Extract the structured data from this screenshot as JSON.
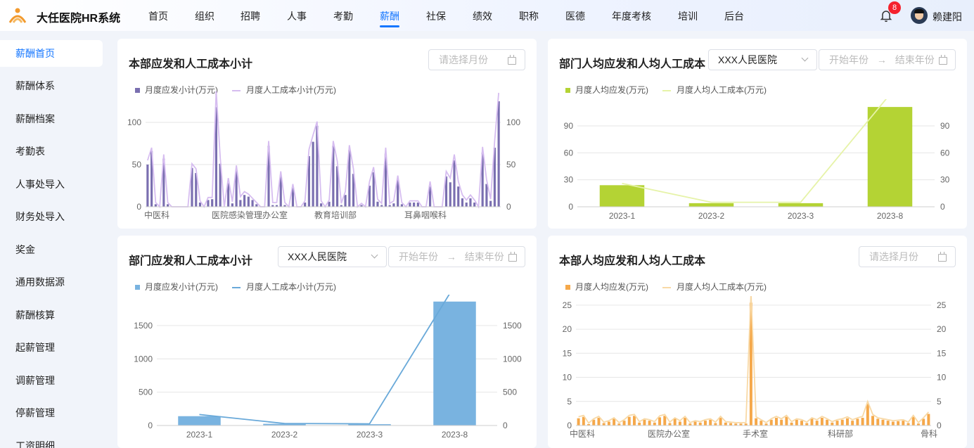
{
  "app": {
    "title": "大任医院HR系统"
  },
  "nav": [
    {
      "label": "首页",
      "active": false
    },
    {
      "label": "组织",
      "active": false
    },
    {
      "label": "招聘",
      "active": false
    },
    {
      "label": "人事",
      "active": false
    },
    {
      "label": "考勤",
      "active": false
    },
    {
      "label": "薪酬",
      "active": true
    },
    {
      "label": "社保",
      "active": false
    },
    {
      "label": "绩效",
      "active": false
    },
    {
      "label": "职称",
      "active": false
    },
    {
      "label": "医德",
      "active": false
    },
    {
      "label": "年度考核",
      "active": false
    },
    {
      "label": "培训",
      "active": false
    },
    {
      "label": "后台",
      "active": false
    }
  ],
  "user": {
    "name": "赖建阳",
    "notifications": "8"
  },
  "sidebar": [
    {
      "label": "薪酬首页",
      "active": true
    },
    {
      "label": "薪酬体系"
    },
    {
      "label": "薪酬档案"
    },
    {
      "label": "考勤表"
    },
    {
      "label": "人事处导入"
    },
    {
      "label": "财务处导入"
    },
    {
      "label": "奖金"
    },
    {
      "label": "通用数据源"
    },
    {
      "label": "薪酬核算"
    },
    {
      "label": "起薪管理"
    },
    {
      "label": "调薪管理"
    },
    {
      "label": "停薪管理"
    },
    {
      "label": "工资明细"
    }
  ],
  "colors": {
    "accent": "#1677ff",
    "purple": "#7a6fb0",
    "purple_line": "#d6bdf0",
    "green": "#b4d334",
    "green_line": "#e6f3a8",
    "blue": "#79b3e0",
    "blue_line": "#69a9d9",
    "orange": "#f5a84a",
    "orange_line": "#f8d9a6"
  },
  "cards": {
    "c1": {
      "title": "本部应发和人工成本小计",
      "month_placeholder": "请选择月份"
    },
    "c2": {
      "title": "部门人均应发和人均人工成本",
      "hospital": "XXX人民医院",
      "start_placeholder": "开始年份",
      "end_placeholder": "结束年份",
      "arrow": "→"
    },
    "c3": {
      "title": "部门应发和人工成本小计",
      "hospital": "XXX人民医院",
      "start_placeholder": "开始年份",
      "end_placeholder": "结束年份",
      "arrow": "→"
    },
    "c4": {
      "title": "本部人均应发和人均人工成本",
      "month_placeholder": "请选择月份"
    }
  },
  "chart_data": [
    {
      "type": "bar",
      "legend": [
        "月度应发小计(万元)",
        "月度人工成本小计(万元)"
      ],
      "x_tick_labels": [
        "中医科",
        "医院感染管理办公室",
        "教育培训部",
        "耳鼻咽喉科"
      ],
      "y_ticks": [
        0,
        50,
        100
      ],
      "ylim": [
        0,
        135
      ],
      "series": [
        {
          "name": "月度应发小计(万元)",
          "kind": "bar",
          "values": [
            50,
            66,
            3,
            0,
            57,
            3,
            0,
            0,
            0,
            0,
            0,
            46,
            40,
            5,
            0,
            8,
            9,
            118,
            51,
            0,
            28,
            4,
            43,
            8,
            14,
            12,
            8,
            3,
            0,
            0,
            72,
            2,
            2,
            37,
            2,
            0,
            23,
            0,
            0,
            5,
            60,
            77,
            96,
            4,
            0,
            6,
            72,
            48,
            2,
            14,
            67,
            39,
            0,
            2,
            0,
            25,
            41,
            6,
            2,
            63,
            2,
            4,
            32,
            3,
            0,
            5,
            5,
            5,
            0,
            0,
            24,
            0,
            0,
            0,
            36,
            29,
            55,
            24,
            10,
            5,
            10,
            5,
            0,
            64,
            27,
            7,
            70,
            125
          ]
        },
        {
          "name": "月度人工成本小计(万元)",
          "kind": "line",
          "values": [
            55,
            70,
            5,
            0,
            62,
            5,
            0,
            0,
            0,
            0,
            0,
            51,
            45,
            7,
            0,
            11,
            11,
            137,
            58,
            0,
            34,
            6,
            49,
            12,
            18,
            15,
            10,
            5,
            0,
            0,
            78,
            5,
            5,
            42,
            5,
            0,
            27,
            0,
            0,
            7,
            68,
            85,
            101,
            7,
            0,
            8,
            78,
            54,
            4,
            18,
            73,
            45,
            0,
            4,
            0,
            30,
            47,
            9,
            4,
            70,
            4,
            7,
            37,
            5,
            0,
            7,
            7,
            7,
            0,
            0,
            30,
            0,
            0,
            0,
            42,
            34,
            62,
            30,
            14,
            8,
            14,
            8,
            0,
            71,
            32,
            9,
            78,
            135
          ]
        }
      ]
    },
    {
      "type": "bar",
      "legend": [
        "月度人均应发(万元)",
        "月度人均人工成本(万元)"
      ],
      "categories": [
        "2023-1",
        "2023-2",
        "2023-3",
        "2023-8"
      ],
      "y_ticks": [
        0,
        30,
        60,
        90
      ],
      "ylim": [
        0,
        115
      ],
      "series": [
        {
          "name": "月度人均应发(万元)",
          "kind": "bar",
          "values": [
            24,
            4,
            4,
            111
          ]
        },
        {
          "name": "月度人均人工成本(万元)",
          "kind": "line",
          "values": [
            26,
            5,
            5,
            125
          ]
        }
      ]
    },
    {
      "type": "bar",
      "legend": [
        "月度应发小计(万元)",
        "月度人工成本小计(万元)"
      ],
      "categories": [
        "2023-1",
        "2023-2",
        "2023-3",
        "2023-8"
      ],
      "y_ticks": [
        0,
        500,
        1000,
        1500
      ],
      "ylim": [
        0,
        1900
      ],
      "series": [
        {
          "name": "月度应发小计(万元)",
          "kind": "bar",
          "values": [
            140,
            25,
            20,
            1860
          ]
        },
        {
          "name": "月度人工成本小计(万元)",
          "kind": "line",
          "values": [
            165,
            30,
            25,
            2100
          ]
        }
      ]
    },
    {
      "type": "bar",
      "legend": [
        "月度人均应发(万元)",
        "月度人均人工成本(万元)"
      ],
      "x_tick_labels": [
        "中医科",
        "医院办公室",
        "手术室",
        "科研部",
        "骨科"
      ],
      "y_ticks": [
        0,
        5,
        10,
        15,
        20,
        25
      ],
      "ylim": [
        0,
        26
      ],
      "series": [
        {
          "name": "月度人均应发(万元)",
          "kind": "bar",
          "values": [
            1.5,
            1.8,
            0.3,
            1.2,
            1.6,
            0.5,
            0.8,
            1.4,
            0.4,
            1.0,
            1.8,
            2.0,
            0.6,
            1.2,
            1.0,
            0.6,
            1.7,
            2.0,
            0.5,
            1.4,
            0.8,
            1.6,
            0.4,
            0.8,
            0.6,
            1.0,
            1.2,
            0.5,
            1.6,
            0.6,
            0.5,
            0.4,
            0.4,
            0.4,
            25.5,
            1.5,
            1.0,
            0.4,
            1.2,
            1.6,
            1.2,
            1.8,
            0.6,
            1.2,
            1.0,
            0.5,
            1.4,
            1.0,
            1.6,
            1.2,
            0.6,
            1.0,
            1.2,
            1.5,
            1.0,
            1.4,
            1.6,
            4.5,
            2.0,
            1.4,
            1.2,
            1.0,
            0.8,
            0.9,
            1.0,
            0.5,
            1.8,
            0.4,
            1.4,
            2.4
          ]
        },
        {
          "name": "月度人均人工成本(万元)",
          "kind": "line",
          "values": [
            1.8,
            2.1,
            0.5,
            1.4,
            1.9,
            0.7,
            1.0,
            1.6,
            0.6,
            1.2,
            2.1,
            2.3,
            0.8,
            1.4,
            1.2,
            0.8,
            2.0,
            2.3,
            0.7,
            1.6,
            1.0,
            1.9,
            0.6,
            1.0,
            0.8,
            1.2,
            1.4,
            0.7,
            1.9,
            0.8,
            0.7,
            0.6,
            0.6,
            0.6,
            27.5,
            1.8,
            1.2,
            0.6,
            1.4,
            1.9,
            1.4,
            2.1,
            0.8,
            1.4,
            1.2,
            0.7,
            1.6,
            1.2,
            1.9,
            1.4,
            0.8,
            1.2,
            1.4,
            1.8,
            1.2,
            1.6,
            1.9,
            5.0,
            2.3,
            1.6,
            1.4,
            1.2,
            1.0,
            1.1,
            1.2,
            0.7,
            2.1,
            0.6,
            1.6,
            2.8
          ]
        }
      ]
    }
  ]
}
